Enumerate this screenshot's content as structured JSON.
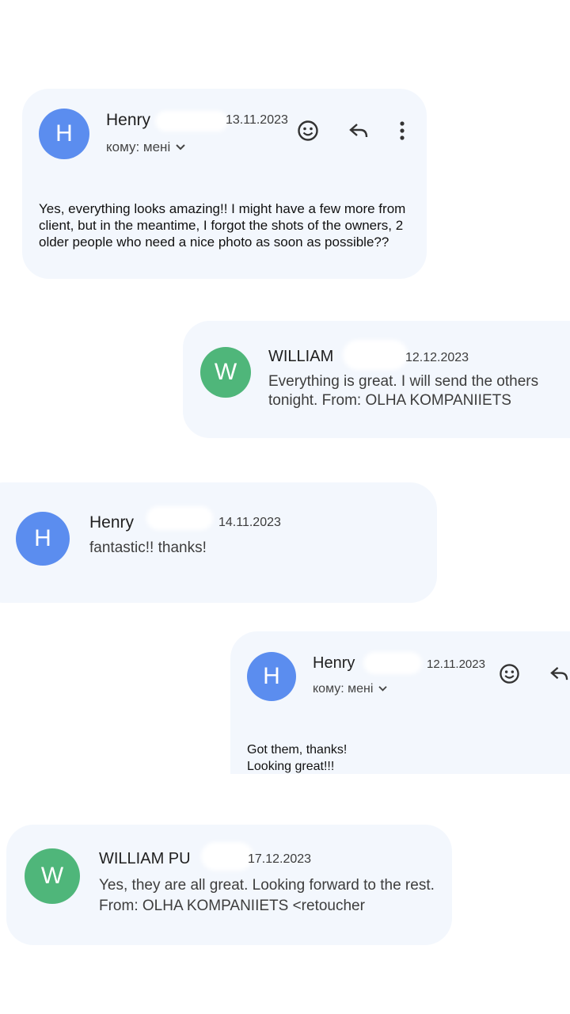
{
  "colors": {
    "card_bg": "#f3f7fd",
    "avatar_blue": "#5b8def",
    "avatar_green": "#4fb67a"
  },
  "cards": [
    {
      "avatar": "H",
      "sender": "Henry",
      "date": "13.11.2023",
      "to": "кому: мені",
      "body": "Yes, everything looks amazing!! I might have a few more from client,  but in the meantime, I forgot the shots of the owners, 2 older people who need a nice photo as soon as possible??"
    },
    {
      "avatar": "W",
      "sender": "WILLIAM",
      "date": "12.12.2023",
      "preview": "Everything is great. I will send the others tonight. From: OLHA KOMPANIIETS"
    },
    {
      "avatar": "H",
      "sender": "Henry",
      "date": "14.11.2023",
      "preview": "fantastic!! thanks!"
    },
    {
      "avatar": "H",
      "sender": "Henry",
      "date": "12.11.2023",
      "to": "кому: мені",
      "body_line1": "Got them, thanks!",
      "body_line2": "Looking great!!!"
    },
    {
      "avatar": "W",
      "sender": "WILLIAM PU",
      "date": "17.12.2023",
      "preview": "Yes, they are all great. Looking forward to the rest. From: OLHA KOMPANIIETS <retoucher"
    }
  ],
  "icons": [
    "emoji-icon",
    "reply-icon",
    "more-vert-icon",
    "chevron-down-icon"
  ]
}
